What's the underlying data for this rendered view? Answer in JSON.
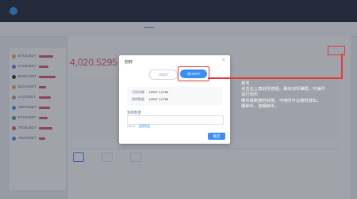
{
  "sidebar": {
    "items": [
      {
        "label": "BTC/USDT",
        "dot_color": "#f0a93a",
        "bar": 0.6
      },
      {
        "label": "ETH/USDT",
        "dot_color": "#6b7ef2",
        "bar": 0.4
      },
      {
        "label": "EOS/USDT",
        "dot_color": "#333333",
        "bar": 0.7
      },
      {
        "label": "BCH/USDT",
        "dot_color": "#f0a93a",
        "bar": 0.3
      },
      {
        "label": "LTC/USDT",
        "dot_color": "#9aa2b2",
        "bar": 0.5
      },
      {
        "label": "XRP/USDT",
        "dot_color": "#3a8ef6",
        "bar": 0.45
      },
      {
        "label": "ETC/USDT",
        "dot_color": "#3aa76d",
        "bar": 0.35
      },
      {
        "label": "TRX/USDT",
        "dot_color": "#e0526a",
        "bar": 0.55
      },
      {
        "label": "ADA/USDT",
        "dot_color": "#3a8ef6",
        "bar": 0.25
      }
    ]
  },
  "main": {
    "price": "4,020.5295"
  },
  "modal": {
    "title": "划转",
    "close_icon": "×",
    "toggle_left": "USDT",
    "toggle_right": "@USDT",
    "info": [
      {
        "label": "可用余额",
        "value": "USDT 1,0765"
      },
      {
        "label": "划转数量",
        "value": "USDT 1,0765"
      }
    ],
    "amount_label": "划转数量",
    "amount_placeholder": "",
    "limit_text": "USDT",
    "limit_link": "全部划出",
    "confirm": "确定"
  },
  "annotation": {
    "lines": [
      "划币",
      "点击右上角划币按钮，弹出划币弹框，可操作",
      "进行划币",
      "哪币转账随时转账，不用时可以随时转出，",
      "哪种币，选哪种币。"
    ]
  },
  "colors": {
    "accent": "#3a8ef6",
    "highlight": "#e53935",
    "price_down": "#e0526a"
  }
}
